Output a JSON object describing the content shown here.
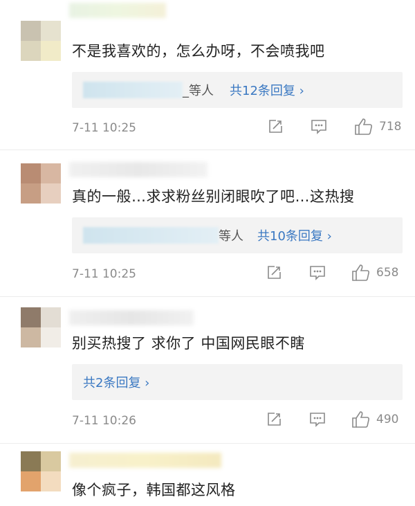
{
  "comments": [
    {
      "text": "不是我喜欢的，怎么办呀，不会喷我吧",
      "reply_suffix": "_等人",
      "reply_count": "共12条回复 ›",
      "time": "7-11 10:25",
      "likes": "718"
    },
    {
      "text": "真的一般…求求粉丝别闭眼吹了吧…这热搜",
      "reply_suffix": "等人",
      "reply_count": "共10条回复 ›",
      "time": "7-11 10:25",
      "likes": "658"
    },
    {
      "text": "别买热搜了 求你了 中国网民眼不瞎",
      "reply_suffix": "",
      "reply_count": "共2条回复 ›",
      "time": "7-11 10:26",
      "likes": "490"
    },
    {
      "text": "像个疯子，韩国都这风格"
    }
  ],
  "colors": {
    "reply_link": "#3a78c2",
    "meta_gray": "#8a8a8a"
  },
  "icons": [
    "share-icon",
    "comment-icon",
    "like-icon"
  ]
}
